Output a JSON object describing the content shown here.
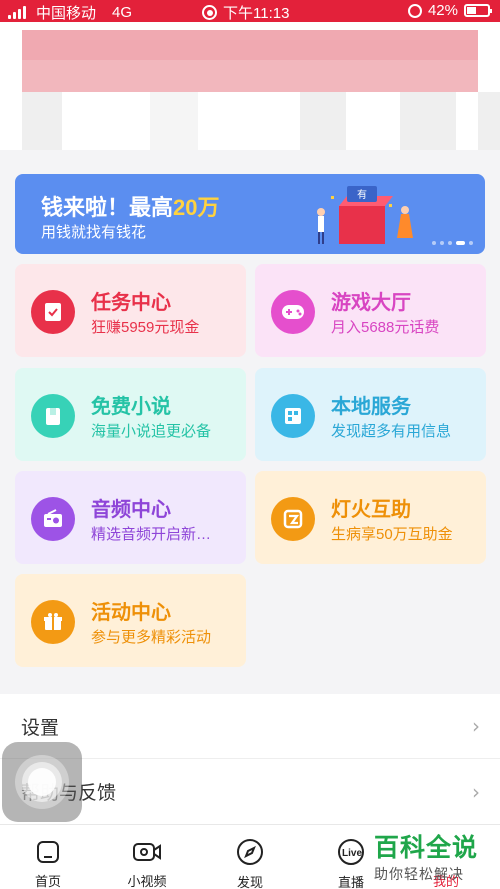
{
  "status_bar": {
    "carrier": "中国移动",
    "network": "4G",
    "time": "下午11:13",
    "battery": "42%",
    "battery_level": 0.42
  },
  "banner": {
    "title_prefix": "钱来啦！最高",
    "title_highlight": "20万",
    "subtitle": "用钱就找有钱花",
    "colors": {
      "background": "#5b8ef0",
      "highlight": "#ffd23f"
    }
  },
  "services": [
    {
      "title": "任务中心",
      "subtitle": "狂赚5959元现金",
      "icon": "task-icon"
    },
    {
      "title": "游戏大厅",
      "subtitle": "月入5688元话费",
      "icon": "gamepad-icon"
    },
    {
      "title": "免费小说",
      "subtitle": "海量小说追更必备",
      "icon": "book-icon"
    },
    {
      "title": "本地服务",
      "subtitle": "发现超多有用信息",
      "icon": "local-service-icon"
    },
    {
      "title": "音频中心",
      "subtitle": "精选音频开启新…",
      "icon": "radio-icon"
    },
    {
      "title": "灯火互助",
      "subtitle": "生病享50万互助金",
      "icon": "mutual-aid-icon"
    },
    {
      "title": "活动中心",
      "subtitle": "参与更多精彩活动",
      "icon": "gift-icon"
    }
  ],
  "settings_list": [
    {
      "label": "设置"
    },
    {
      "label": "帮助与反馈"
    }
  ],
  "tabbar": [
    {
      "label": "首页",
      "icon": "home-icon"
    },
    {
      "label": "小视频",
      "icon": "video-camera-icon"
    },
    {
      "label": "发现",
      "icon": "compass-icon"
    },
    {
      "label": "直播",
      "icon": "live-icon"
    },
    {
      "label": "我的",
      "icon": "profile-icon",
      "active": true
    }
  ],
  "watermark": {
    "line1": "百科全说",
    "line2": "助你轻松解决"
  }
}
